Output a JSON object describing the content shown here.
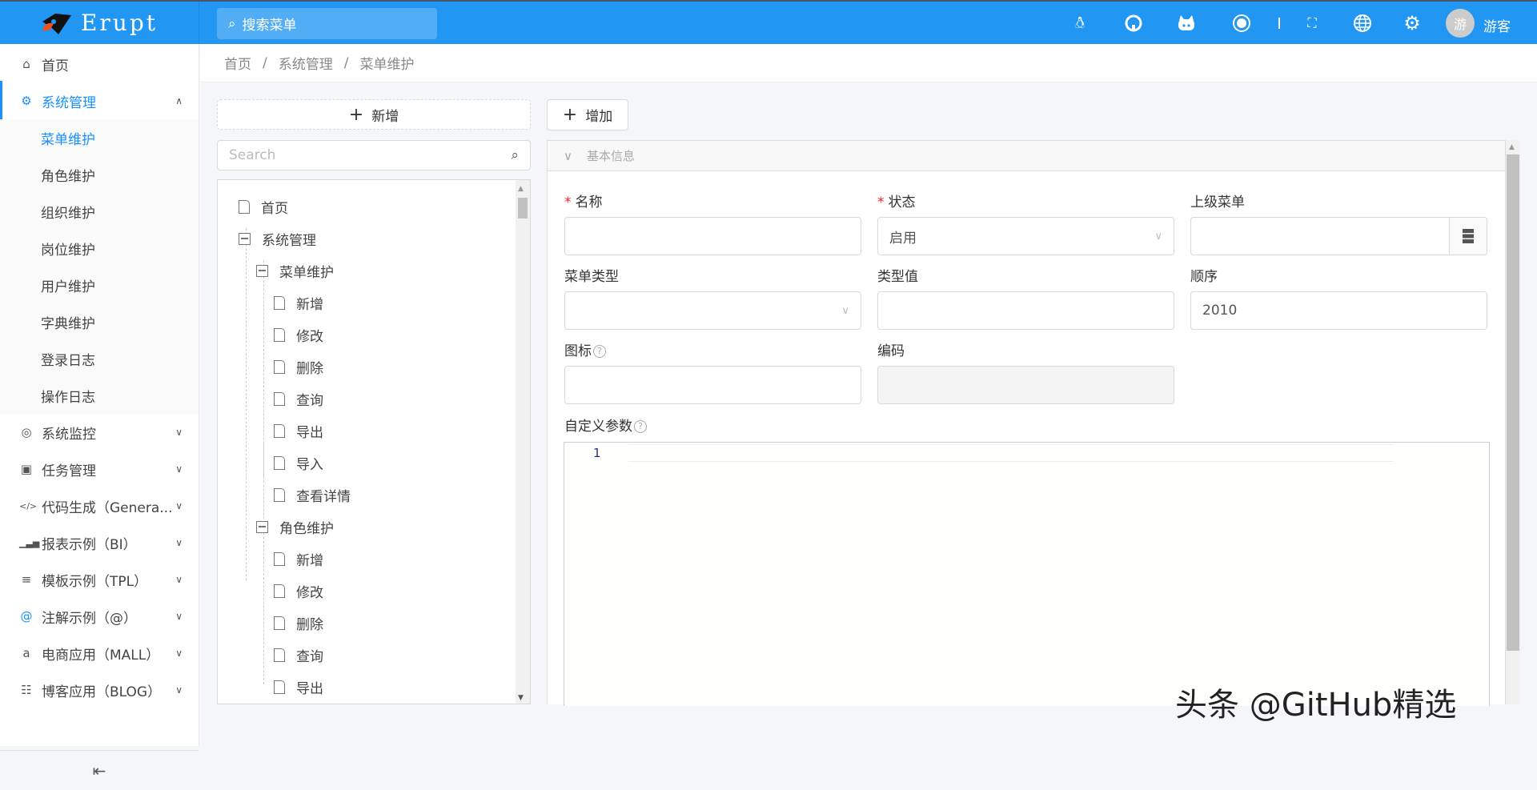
{
  "header": {
    "logo_text": "Erupt",
    "search_placeholder": "搜索菜单",
    "user_avatar": "游",
    "user_name": "游客",
    "accent": "#2196f3",
    "icons": [
      "qq-icon",
      "github-icon",
      "gitee-icon",
      "circle-logo-icon",
      "fullscreen-icon",
      "language-icon",
      "settings-icon"
    ]
  },
  "sidebar": {
    "items": [
      {
        "label": "首页",
        "icon": "home-icon"
      },
      {
        "label": "系统管理",
        "icon": "cogs-icon",
        "expanded": true
      },
      {
        "label": "菜单维护",
        "sub": true,
        "active": true
      },
      {
        "label": "角色维护",
        "sub": true
      },
      {
        "label": "组织维护",
        "sub": true
      },
      {
        "label": "岗位维护",
        "sub": true
      },
      {
        "label": "用户维护",
        "sub": true
      },
      {
        "label": "字典维护",
        "sub": true
      },
      {
        "label": "登录日志",
        "sub": true
      },
      {
        "label": "操作日志",
        "sub": true
      },
      {
        "label": "系统监控",
        "icon": "target-icon"
      },
      {
        "label": "任务管理",
        "icon": "cubes-icon"
      },
      {
        "label": "代码生成（Genera...",
        "icon": "code-icon"
      },
      {
        "label": "报表示例（BI）",
        "icon": "bar-chart-icon"
      },
      {
        "label": "模板示例（TPL）",
        "icon": "template-icon"
      },
      {
        "label": "注解示例（@）",
        "icon": "at-icon"
      },
      {
        "label": "电商应用（MALL）",
        "icon": "amazon-icon"
      },
      {
        "label": "博客应用（BLOG）",
        "icon": "file-text-icon"
      }
    ]
  },
  "breadcrumb": [
    "首页",
    "系统管理",
    "菜单维护"
  ],
  "tree": {
    "add_label": "新增",
    "search_placeholder": "Search",
    "nodes": [
      {
        "label": "首页",
        "level": 0,
        "type": "file"
      },
      {
        "label": "系统管理",
        "level": 0,
        "type": "open"
      },
      {
        "label": "菜单维护",
        "level": 1,
        "type": "open"
      },
      {
        "label": "新增",
        "level": 2,
        "type": "file"
      },
      {
        "label": "修改",
        "level": 2,
        "type": "file"
      },
      {
        "label": "删除",
        "level": 2,
        "type": "file"
      },
      {
        "label": "查询",
        "level": 2,
        "type": "file"
      },
      {
        "label": "导出",
        "level": 2,
        "type": "file"
      },
      {
        "label": "导入",
        "level": 2,
        "type": "file"
      },
      {
        "label": "查看详情",
        "level": 2,
        "type": "file"
      },
      {
        "label": "角色维护",
        "level": 1,
        "type": "open"
      },
      {
        "label": "新增",
        "level": 2,
        "type": "file"
      },
      {
        "label": "修改",
        "level": 2,
        "type": "file"
      },
      {
        "label": "删除",
        "level": 2,
        "type": "file"
      },
      {
        "label": "查询",
        "level": 2,
        "type": "file"
      },
      {
        "label": "导出",
        "level": 2,
        "type": "file"
      }
    ]
  },
  "form": {
    "add_label": "增加",
    "section_title": "基本信息",
    "name_label": "名称",
    "status_label": "状态",
    "status_value": "启用",
    "parent_label": "上级菜单",
    "type_label": "菜单类型",
    "type_value_label": "类型值",
    "order_label": "顺序",
    "order_value": "2010",
    "icon_label": "图标",
    "code_label": "编码",
    "params_label": "自定义参数",
    "editor_line": "1"
  },
  "watermark": "头条 @GitHub精选"
}
